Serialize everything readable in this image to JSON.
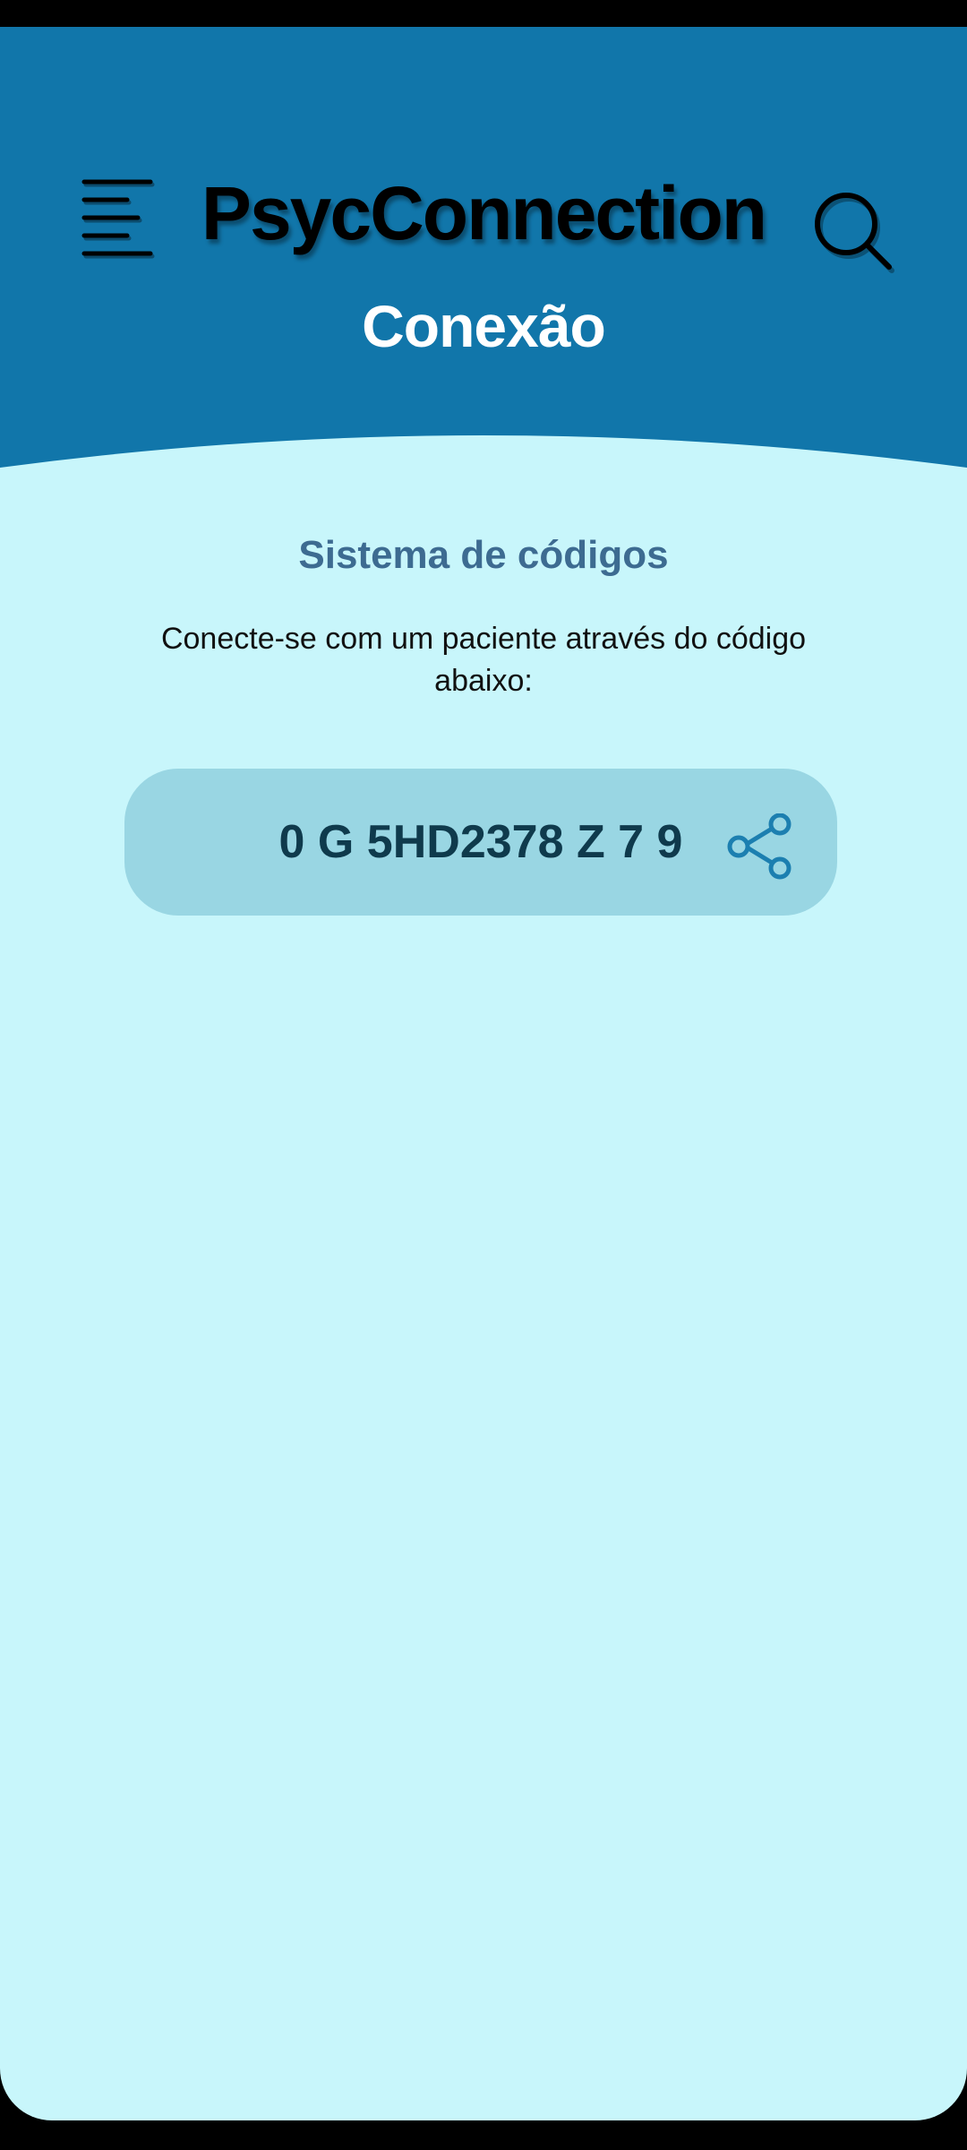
{
  "header": {
    "app_title": "PsycConnection",
    "section_title": "Conexão",
    "menu_icon": "menu-icon",
    "search_icon": "search-icon",
    "background_color": "#1176aa"
  },
  "content": {
    "subtitle": "Sistema de códigos",
    "description": "Conecte-se com um paciente através do código abaixo:",
    "code": "0 G 5HD2378 Z 7 9",
    "share_icon": "share-icon",
    "background_color": "#c8f6fb",
    "code_box_color": "#99d6e3",
    "accent_color": "#1c7fb0"
  }
}
